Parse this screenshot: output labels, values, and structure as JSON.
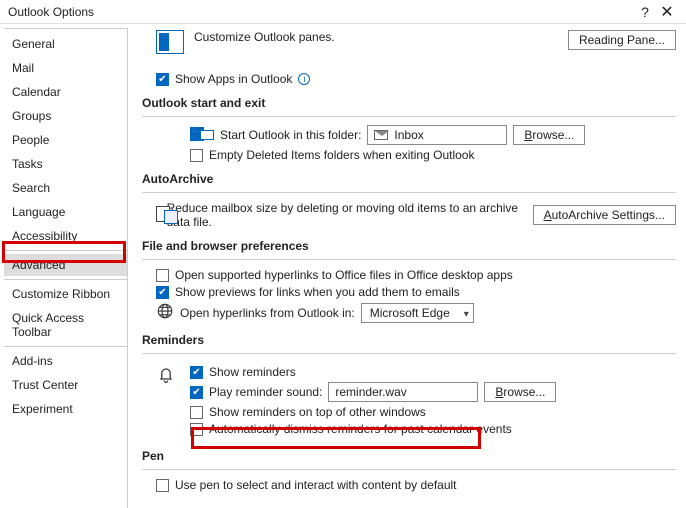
{
  "window": {
    "title": "Outlook Options"
  },
  "sidebar": {
    "items": [
      "General",
      "Mail",
      "Calendar",
      "Groups",
      "People",
      "Tasks",
      "Search",
      "Language",
      "Accessibility",
      "Advanced",
      "Customize Ribbon",
      "Quick Access Toolbar",
      "Add-ins",
      "Trust Center",
      "Experiment"
    ],
    "selected": "Advanced"
  },
  "panes": {
    "customize_text": "Customize Outlook panes.",
    "reading_pane_btn": "Reading Pane...",
    "show_apps": "Show Apps in Outlook"
  },
  "start_exit": {
    "heading": "Outlook start and exit",
    "start_folder_label": "Start Outlook in this folder:",
    "folder_value": "Inbox",
    "browse": "Browse...",
    "empty_deleted": "Empty Deleted Items folders when exiting Outlook"
  },
  "autoarchive": {
    "heading": "AutoArchive",
    "desc": "Reduce mailbox size by deleting or moving old items to an archive data file.",
    "btn": "AutoArchive Settings..."
  },
  "file_browser": {
    "heading": "File and browser preferences",
    "open_office": "Open supported hyperlinks to Office files in Office desktop apps",
    "show_previews": "Show previews for links when you add them to emails",
    "open_links_label": "Open hyperlinks from Outlook in:",
    "browser_value": "Microsoft Edge"
  },
  "reminders": {
    "heading": "Reminders",
    "show": "Show reminders",
    "play_label": "Play reminder sound:",
    "sound_value": "reminder.wav",
    "browse": "Browse...",
    "on_top": "Show reminders on top of other windows",
    "auto_dismiss": "Automatically dismiss reminders for past calendar events"
  },
  "pen": {
    "heading": "Pen",
    "use_pen": "Use pen to select and interact with content by default"
  }
}
